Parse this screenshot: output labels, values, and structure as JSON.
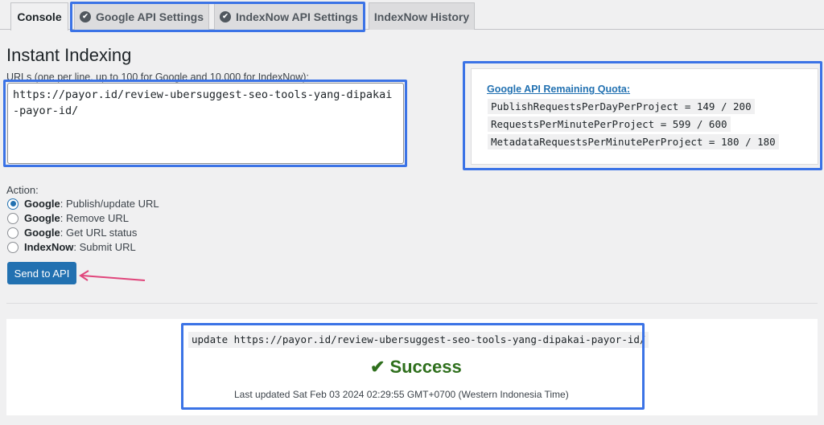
{
  "tabs": {
    "console": "Console",
    "google_settings": "Google API Settings",
    "indexnow_settings": "IndexNow API Settings",
    "indexnow_history": "IndexNow History"
  },
  "page": {
    "title": "Instant Indexing",
    "urls_label": "URLs (one per line, up to 100 for Google and 10,000 for IndexNow):",
    "urls_value": "https://payor.id/review-ubersuggest-seo-tools-yang-dipakai-payor-id/"
  },
  "action": {
    "label": "Action:",
    "options": [
      {
        "service": "Google",
        "text": ": Publish/update URL",
        "checked": true
      },
      {
        "service": "Google",
        "text": ": Remove URL",
        "checked": false
      },
      {
        "service": "Google",
        "text": ": Get URL status",
        "checked": false
      },
      {
        "service": "IndexNow",
        "text": ": Submit URL",
        "checked": false
      }
    ],
    "send_label": "Send to API"
  },
  "quota": {
    "title": "Google API Remaining Quota:",
    "lines": [
      "PublishRequestsPerDayPerProject = 149 / 200",
      "RequestsPerMinutePerProject = 599 / 600",
      "MetadataRequestsPerMinutePerProject = 180 / 180"
    ]
  },
  "result": {
    "command": "update https://payor.id/review-ubersuggest-seo-tools-yang-dipakai-payor-id/",
    "status": "Success",
    "updated": "Last updated Sat Feb 03 2024 02:29:55 GMT+0700 (Western Indonesia Time)"
  },
  "colors": {
    "highlight": "#3b73e6",
    "primary": "#2271b1",
    "success": "#2e6f1c",
    "arrow": "#e0457b"
  }
}
